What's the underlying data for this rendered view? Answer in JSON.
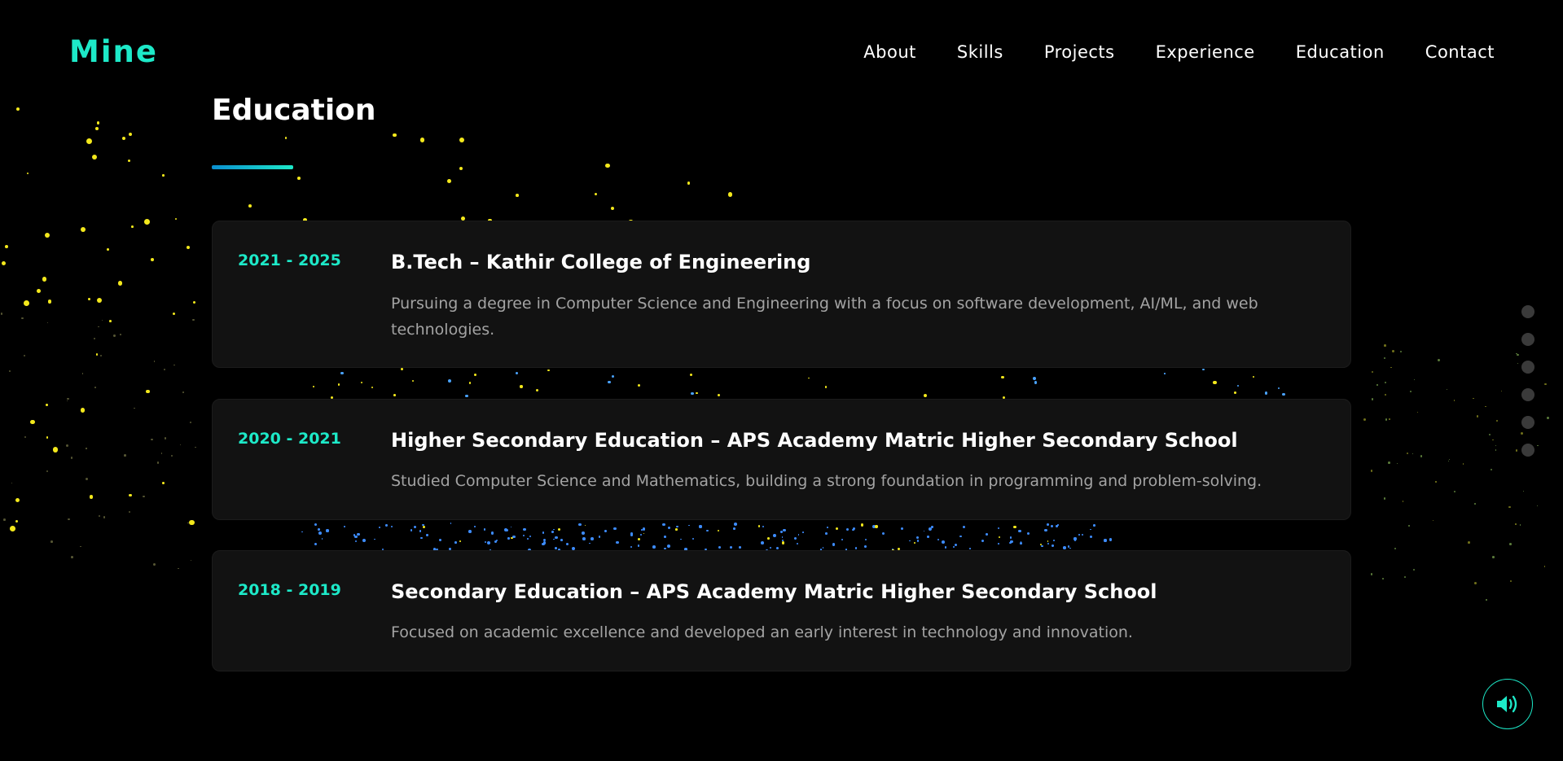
{
  "brand": {
    "logo": "Mine",
    "accent": "#1de9c8"
  },
  "nav": {
    "items": [
      "About",
      "Skills",
      "Projects",
      "Experience",
      "Education",
      "Contact"
    ]
  },
  "section": {
    "title": "Education"
  },
  "education": [
    {
      "years": "2021 - 2025",
      "title": "B.Tech – Kathir College of Engineering",
      "description": "Pursuing a degree in Computer Science and Engineering with a focus on software development, AI/ML, and web technologies."
    },
    {
      "years": "2020 - 2021",
      "title": "Higher Secondary Education – APS Academy Matric Higher Secondary School",
      "description": "Studied Computer Science and Mathematics, building a strong foundation in programming and problem-solving."
    },
    {
      "years": "2018 - 2019",
      "title": "Secondary Education – APS Academy Matric Higher Secondary School",
      "description": "Focused on academic excellence and developed an early interest in technology and innovation."
    }
  ],
  "side_nav": {
    "dot_count": 6
  },
  "sound_button": {
    "icon": "speaker-icon"
  }
}
